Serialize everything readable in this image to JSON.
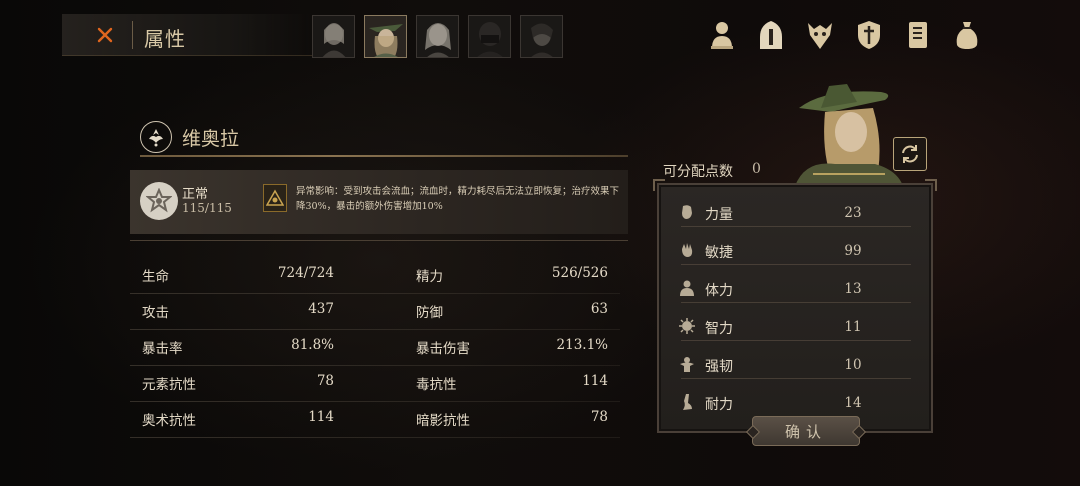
{
  "header": {
    "title": "属性",
    "portraits": [
      "portrait-1",
      "portrait-2",
      "portrait-3",
      "portrait-4",
      "portrait-5"
    ],
    "active_portrait": 1,
    "menu_icons": [
      "hero-bust-icon",
      "helmet-icon",
      "beast-skull-icon",
      "shield-icon",
      "book-icon",
      "pouch-icon"
    ]
  },
  "character": {
    "name": "维奥拉",
    "status": {
      "name": "正常",
      "value": "115/115",
      "effect": "异常影响：受到攻击会流血；流血时，精力耗尽后无法立即恢复；治疗效果下降30%，暴击的额外伤害增加10%"
    }
  },
  "stats": [
    {
      "label": "生命",
      "value": "724/724",
      "label2": "精力",
      "value2": "526/526"
    },
    {
      "label": "攻击",
      "value": "437",
      "label2": "防御",
      "value2": "63"
    },
    {
      "label": "暴击率",
      "value": "81.8%",
      "label2": "暴击伤害",
      "value2": "213.1%"
    },
    {
      "label": "元素抗性",
      "value": "78",
      "label2": "毒抗性",
      "value2": "114"
    },
    {
      "label": "奥术抗性",
      "value": "114",
      "label2": "暗影抗性",
      "value2": "78"
    }
  ],
  "attributes": {
    "points_label": "可分配点数",
    "points_value": "0",
    "items": [
      {
        "icon": "fist-icon",
        "label": "力量",
        "value": "23"
      },
      {
        "icon": "hand-icon",
        "label": "敏捷",
        "value": "99"
      },
      {
        "icon": "person-icon",
        "label": "体力",
        "value": "13"
      },
      {
        "icon": "brain-icon",
        "label": "智力",
        "value": "11"
      },
      {
        "icon": "flex-icon",
        "label": "强韧",
        "value": "10"
      },
      {
        "icon": "boot-icon",
        "label": "耐力",
        "value": "14"
      }
    ],
    "confirm_label": "确认"
  },
  "colors": {
    "accent": "#d8c8a6",
    "close": "#e0661e"
  }
}
